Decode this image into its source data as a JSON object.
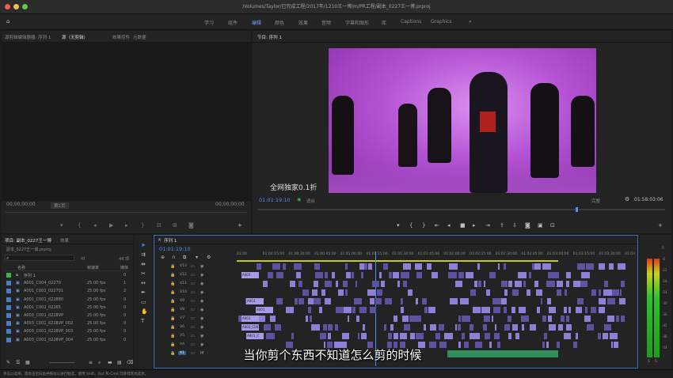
{
  "titlebar": {
    "path": "/Volumes/Taylor/已完成工程/2017年/1210王一博/m/PR工程/副本_0227王一博.prproj"
  },
  "workspaces": [
    "学习",
    "组件",
    "编辑",
    "颜色",
    "效果",
    "音频",
    "字幕和图形",
    "库",
    "Captions",
    "Graphics"
  ],
  "workspace_active": "编辑",
  "source_panel": {
    "tabs": [
      "源剪辑编辑器器: 序列 1",
      "源（无剪辑）",
      "效果控件",
      "元数据"
    ],
    "timecode_left": "00;00;00;00",
    "timecode_right": "00;00;00;00",
    "page": "第1页"
  },
  "program_panel": {
    "tab": "节目: 序列 1",
    "timecode": "01:01:19:10",
    "fit": "适合",
    "quality": "完整",
    "duration": "01:58:03:06"
  },
  "project_panel": {
    "tabs": [
      "项目: 副本_0227王一博",
      "效果"
    ],
    "file": "副本_0227王一博.prproj",
    "count": "44 项",
    "columns": [
      "名称",
      "帧速率",
      "媒体"
    ],
    "items": [
      {
        "name": "序列 1",
        "fps": "",
        "media": "0",
        "color": "#3cb44b",
        "icon": "sequence"
      },
      {
        "name": "A001_C004_02270",
        "fps": "25.00 fps",
        "media": "1",
        "color": "#4a7ec2",
        "icon": "clip"
      },
      {
        "name": "A001_C001_022701",
        "fps": "25.00 fps",
        "media": "2",
        "color": "#4a7ec2",
        "icon": "clip"
      },
      {
        "name": "A001_C001_022880",
        "fps": "25.00 fps",
        "media": "0",
        "color": "#4a7ec2",
        "icon": "clip"
      },
      {
        "name": "A001_C002_02265",
        "fps": "25.00 fps",
        "media": "0",
        "color": "#4a7ec2",
        "icon": "clip"
      },
      {
        "name": "A003_C001_0228VP",
        "fps": "25.00 fps",
        "media": "0",
        "color": "#4a7ec2",
        "icon": "clip"
      },
      {
        "name": "A003_C001_0228VP_002",
        "fps": "25.00 fps",
        "media": "0",
        "color": "#4a7ec2",
        "icon": "clip"
      },
      {
        "name": "A003_C001_0228VP_003",
        "fps": "25.00 fps",
        "media": "0",
        "color": "#4a7ec2",
        "icon": "clip"
      },
      {
        "name": "A003_C001_0228VP_004",
        "fps": "25.00 fps",
        "media": "0",
        "color": "#4a7ec2",
        "icon": "clip"
      }
    ]
  },
  "timeline": {
    "tab": "序列 1",
    "timecode": "01:01:19:10",
    "ruler": [
      "01:00",
      "01:00:15:00",
      "01:00:30:00",
      "01:00:45:00",
      "01:01:00:00",
      "01:01:15:00",
      "01:01:30:00",
      "01:01:45:00",
      "01:02:00:00",
      "01:02:15:00",
      "01:02:30:00",
      "01:02:45:00",
      "01:03:00:00",
      "01:03:15:00",
      "01:03:30:00",
      "01:03"
    ],
    "tracks": [
      "V13",
      "V12",
      "V11",
      "V10",
      "V9",
      "V8",
      "V7",
      "V6",
      "V5",
      "V4",
      "A1"
    ],
    "clip_labels": [
      "A003",
      "A003",
      "A001",
      "A001",
      "A003_C001",
      "A001_C"
    ]
  },
  "video_watermark": "全网独家0.1折",
  "subtitle": "当你剪个东西不知道怎么剪的时候",
  "meters": {
    "scale": [
      "0",
      "-6",
      "-12",
      "-18",
      "-24",
      "-30",
      "-36",
      "-42",
      "-48",
      "-54"
    ],
    "lr": [
      "S",
      "S"
    ]
  },
  "statusbar": "单击以选择，或单击空白处并拖动以进行框选。使用 Shift、Opt 和 Cmd 可获得其他选项。"
}
